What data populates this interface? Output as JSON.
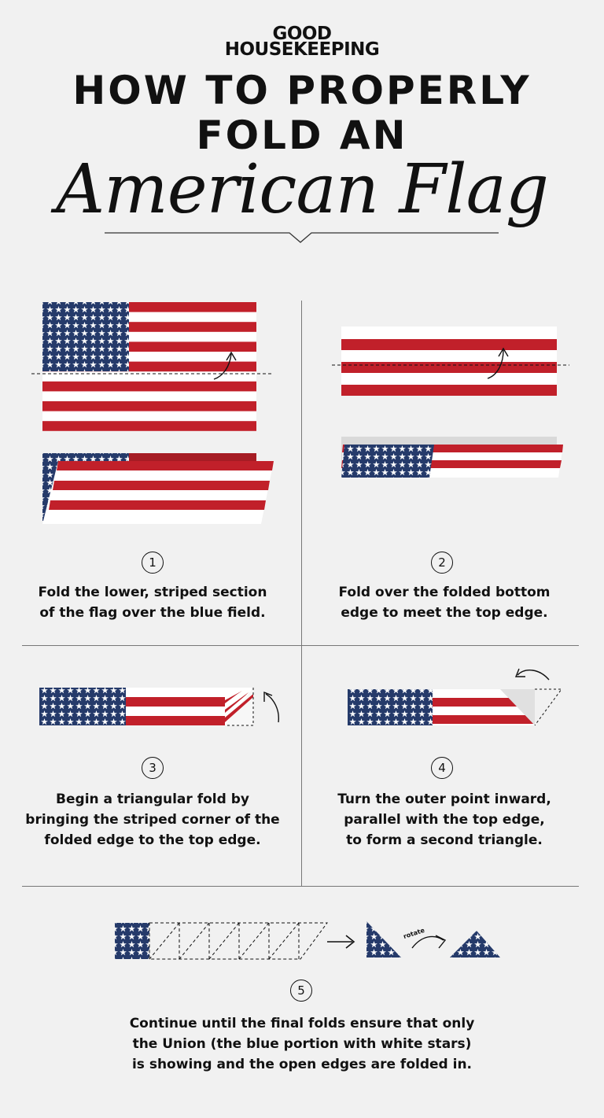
{
  "brand": {
    "line1": "GOOD",
    "line2": "HOUSEKEEPING"
  },
  "title": {
    "line1": "HOW TO PROPERLY",
    "line2": "FOLD AN",
    "line3": "American Flag"
  },
  "colors": {
    "red": "#c1202a",
    "blue": "#253a6a",
    "white": "#ffffff",
    "background": "#f1f1f1"
  },
  "steps": [
    {
      "number": "1",
      "text_lines": [
        "Fold the lower, striped section",
        "of the flag over the blue field."
      ]
    },
    {
      "number": "2",
      "text_lines": [
        "Fold over the folded bottom",
        "edge to meet the top edge."
      ]
    },
    {
      "number": "3",
      "text_lines": [
        "Begin a triangular fold by",
        "bringing the striped corner of the",
        "folded edge to the top edge."
      ]
    },
    {
      "number": "4",
      "text_lines": [
        "Turn the outer point inward,",
        "parallel with the top edge,",
        "to form a second triangle."
      ]
    },
    {
      "number": "5",
      "text_lines": [
        "Continue until the final folds ensure that only",
        "the Union (the blue portion with white stars)",
        "is showing and the open edges are folded in."
      ]
    }
  ],
  "rotate_label": "rotate"
}
